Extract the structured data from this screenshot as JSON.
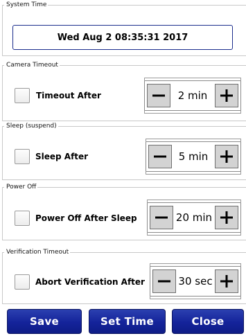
{
  "system_time": {
    "group_title": "System Time",
    "value": "Wed Aug 2 08:35:31 2017"
  },
  "camera_timeout": {
    "group_title": "Camera Timeout",
    "checkbox_label": "Timeout After",
    "checked": false,
    "value": "2 min"
  },
  "sleep": {
    "group_title": "Sleep (suspend)",
    "checkbox_label": "Sleep After",
    "checked": false,
    "value": "5 min"
  },
  "power_off": {
    "group_title": "Power Off",
    "checkbox_label": "Power Off After Sleep",
    "checked": false,
    "value": "20 min"
  },
  "verification_timeout": {
    "group_title": "Verification Timeout",
    "checkbox_label": "Abort Verification After",
    "checked": false,
    "value": "30 sec"
  },
  "buttons": {
    "save": "Save",
    "set_time": "Set Time",
    "close": "Close"
  },
  "icons": {
    "decrement": "minus-icon",
    "increment": "plus-icon"
  },
  "colors": {
    "accent": "#14239a",
    "stepper_button": "#d3d3d3"
  }
}
